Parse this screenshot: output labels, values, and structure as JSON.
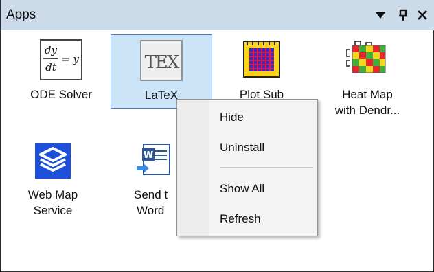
{
  "panel": {
    "title": "Apps",
    "buttons": {
      "dropdown_glyph": "▼",
      "pin_glyph": "𝛑",
      "close_glyph": "✕"
    }
  },
  "apps": [
    {
      "name": "ODE Solver",
      "label1": "ODE Solver",
      "label2": "",
      "icon": "ode-icon",
      "eq_top": "dy",
      "eq_bottom": "dt",
      "eq_rhs": "= y"
    },
    {
      "name": "LaTeX",
      "label1": "LaTeX",
      "label2": "",
      "icon": "tex-icon",
      "logo": "TEX",
      "selected": true
    },
    {
      "name": "Plot Sub",
      "label1": "Plot Sub",
      "label2": "",
      "icon": "grid-plot-icon"
    },
    {
      "name": "Heat Map with Dendr...",
      "label1": "Heat Map",
      "label2": "with Dendr...",
      "icon": "heatmap-icon"
    },
    {
      "name": "Web Map Service",
      "label1": "Web Map",
      "label2": "Service",
      "icon": "layers-icon"
    },
    {
      "name": "Send to Word",
      "label1": "Send t",
      "label2": "Word",
      "icon": "word-icon"
    }
  ],
  "context_menu": {
    "items": [
      {
        "label": "Hide"
      },
      {
        "label": "Uninstall"
      },
      {
        "label": "Show All"
      },
      {
        "label": "Refresh"
      }
    ]
  },
  "colors": {
    "titlebar": "#cbdbea",
    "selection_fill": "#cce4f7",
    "selection_border": "#3a78c2"
  }
}
